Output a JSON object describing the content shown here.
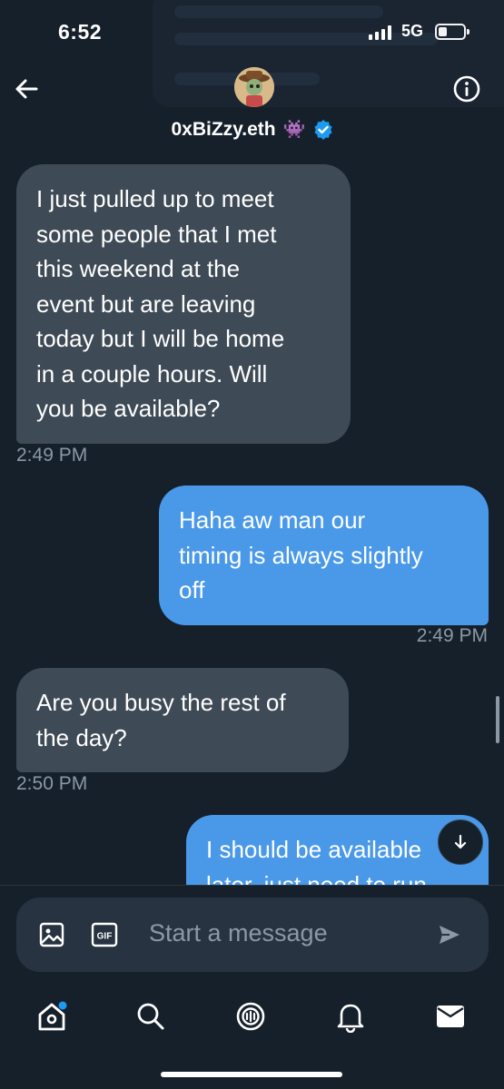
{
  "status_bar": {
    "time": "6:52",
    "network": "5G"
  },
  "header": {
    "contact_name": "0xBiZzy.eth",
    "emoji": "👾"
  },
  "messages": [
    {
      "direction": "in",
      "lines": [
        "I just pulled up to meet",
        "some people that I met",
        "this weekend at the",
        "event but are leaving",
        "today but I will be home",
        "in a couple hours. Will",
        "you be available?"
      ],
      "time": "2:49 PM"
    },
    {
      "direction": "out",
      "lines": [
        "Haha aw man our",
        "timing is always slightly",
        "off"
      ],
      "time": "2:49 PM"
    },
    {
      "direction": "in",
      "lines": [
        "Are you busy the rest of",
        "the day?"
      ],
      "time": "2:50 PM"
    },
    {
      "direction": "out",
      "lines": [
        "I should be available",
        "later, just need to run"
      ],
      "time": ""
    }
  ],
  "composer": {
    "placeholder": "Start a message",
    "gif_label": "GIF"
  },
  "icons": {
    "back": "back-arrow-icon",
    "info": "info-icon",
    "verified": "verified-badge-icon",
    "media": "image-icon",
    "gif": "gif-icon",
    "send": "send-icon",
    "home": "home-icon",
    "search": "search-icon",
    "spaces": "spaces-icon",
    "notifications": "bell-icon",
    "messages": "mail-icon",
    "scroll_down": "arrow-down-icon"
  },
  "colors": {
    "background": "#15202b",
    "incoming_bubble": "#3e4a55",
    "outgoing_bubble": "#4a99e9",
    "accent": "#1d9bf0",
    "muted_text": "#8b98a5"
  }
}
